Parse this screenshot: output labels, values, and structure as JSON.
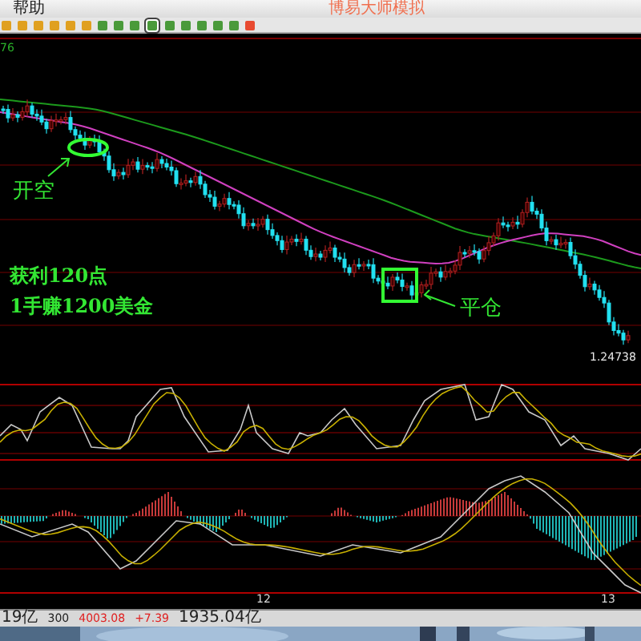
{
  "menu": {
    "label": "帮助"
  },
  "window": {
    "title": "博易大师模拟"
  },
  "toolbar": [
    {
      "kind": "orange",
      "selected": false
    },
    {
      "kind": "orange",
      "selected": false
    },
    {
      "kind": "orange",
      "selected": false
    },
    {
      "kind": "orange",
      "selected": false
    },
    {
      "kind": "orange",
      "selected": false
    },
    {
      "kind": "orange",
      "selected": false
    },
    {
      "kind": "green",
      "selected": false
    },
    {
      "kind": "green",
      "selected": false
    },
    {
      "kind": "green",
      "selected": false
    },
    {
      "kind": "green",
      "selected": true
    },
    {
      "kind": "green",
      "selected": false
    },
    {
      "kind": "green",
      "selected": false
    },
    {
      "kind": "green",
      "selected": false
    },
    {
      "kind": "green",
      "selected": false
    },
    {
      "kind": "green",
      "selected": false
    },
    {
      "kind": "red",
      "selected": false
    }
  ],
  "chart": {
    "axis_value": "76",
    "price_label": "1.24738",
    "annotations": [
      {
        "kind": "entry",
        "text": "开空"
      },
      {
        "kind": "profit",
        "text": "获利120点"
      },
      {
        "kind": "profit",
        "text": "1手赚1200美金"
      },
      {
        "kind": "exit",
        "text": "平仓"
      }
    ],
    "x_labels": [
      "12",
      "13"
    ]
  },
  "status_bar": [
    {
      "kind": "plain",
      "text": "19亿"
    },
    {
      "kind": "plain",
      "text": "300"
    },
    {
      "kind": "up",
      "text": "4003.08"
    },
    {
      "kind": "up",
      "text": "+7.39"
    },
    {
      "kind": "plain",
      "text": "1935.04亿"
    }
  ]
}
